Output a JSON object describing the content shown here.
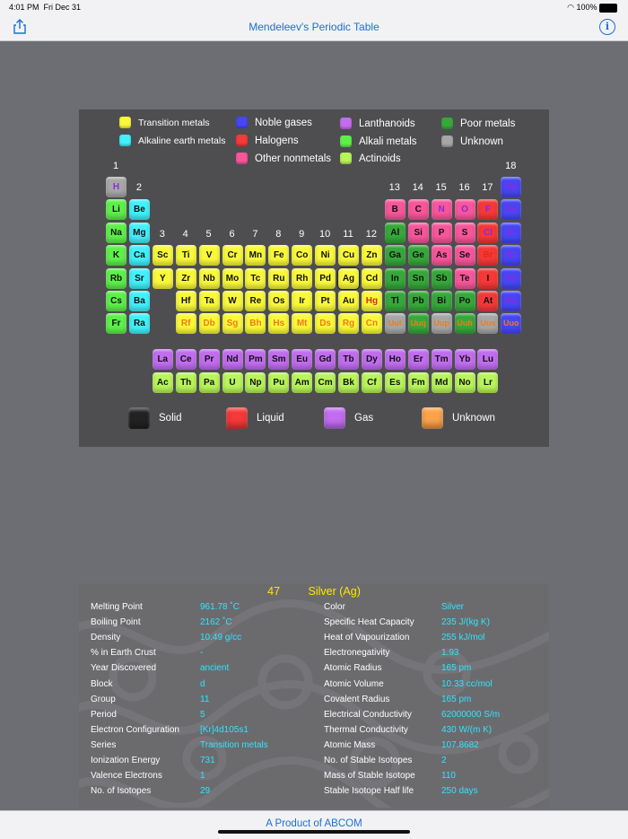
{
  "status": {
    "time": "4:01 PM",
    "date": "Fri Dec 31",
    "battery": "100%"
  },
  "nav": {
    "title": "Mendeleev's Periodic Table",
    "info": "i"
  },
  "colors": {
    "transition": "#f9f93a",
    "alkaline": "#41f1fb",
    "noble": "#4646f5",
    "halogen": "#f53838",
    "nonmetal": "#f7569a",
    "lanthanoid": "#c26df0",
    "alkali": "#5ef04a",
    "actinoid": "#b8f45a",
    "poor": "#36a83a",
    "unknown": "#a7a7a7",
    "accent": "#1a6fd6",
    "highlight": "#ffe700",
    "value": "#2ee6ff"
  },
  "legend": [
    {
      "label": "Transition metals",
      "color": "#f9f93a"
    },
    {
      "label": "Alkaline earth metals",
      "color": "#41f1fb"
    },
    {
      "label": "Noble gases",
      "color": "#4646f5"
    },
    {
      "label": "Halogens",
      "color": "#f53838"
    },
    {
      "label": "Other nonmetals",
      "color": "#f7569a"
    },
    {
      "label": "Lanthanoids",
      "color": "#c26df0"
    },
    {
      "label": "Alkali metals",
      "color": "#5ef04a"
    },
    {
      "label": "Actinoids",
      "color": "#b8f45a"
    },
    {
      "label": "Poor metals",
      "color": "#36a83a"
    },
    {
      "label": "Unknown",
      "color": "#a7a7a7"
    }
  ],
  "groups": [
    "1",
    "2",
    "3",
    "4",
    "5",
    "6",
    "7",
    "8",
    "9",
    "10",
    "11",
    "12",
    "13",
    "14",
    "15",
    "16",
    "17",
    "18"
  ],
  "elements": [
    {
      "symbol": "H",
      "group": 1,
      "period": 1,
      "series": "unknown",
      "state": "gas"
    },
    {
      "symbol": "He",
      "group": 18,
      "period": 1,
      "series": "noble",
      "state": "gas"
    },
    {
      "symbol": "Li",
      "group": 1,
      "period": 2,
      "series": "alkali",
      "state": "solid"
    },
    {
      "symbol": "Be",
      "group": 2,
      "period": 2,
      "series": "alkaline",
      "state": "solid"
    },
    {
      "symbol": "B",
      "group": 13,
      "period": 2,
      "series": "nonmetal",
      "state": "solid"
    },
    {
      "symbol": "C",
      "group": 14,
      "period": 2,
      "series": "nonmetal",
      "state": "solid"
    },
    {
      "symbol": "N",
      "group": 15,
      "period": 2,
      "series": "nonmetal",
      "state": "gas"
    },
    {
      "symbol": "O",
      "group": 16,
      "period": 2,
      "series": "nonmetal",
      "state": "gas"
    },
    {
      "symbol": "F",
      "group": 17,
      "period": 2,
      "series": "halogen",
      "state": "gas"
    },
    {
      "symbol": "Ne",
      "group": 18,
      "period": 2,
      "series": "noble",
      "state": "gas"
    },
    {
      "symbol": "Na",
      "group": 1,
      "period": 3,
      "series": "alkali",
      "state": "solid"
    },
    {
      "symbol": "Mg",
      "group": 2,
      "period": 3,
      "series": "alkaline",
      "state": "solid"
    },
    {
      "symbol": "Al",
      "group": 13,
      "period": 3,
      "series": "poor",
      "state": "solid"
    },
    {
      "symbol": "Si",
      "group": 14,
      "period": 3,
      "series": "nonmetal",
      "state": "solid"
    },
    {
      "symbol": "P",
      "group": 15,
      "period": 3,
      "series": "nonmetal",
      "state": "solid"
    },
    {
      "symbol": "S",
      "group": 16,
      "period": 3,
      "series": "nonmetal",
      "state": "solid"
    },
    {
      "symbol": "Cl",
      "group": 17,
      "period": 3,
      "series": "halogen",
      "state": "gas"
    },
    {
      "symbol": "Ar",
      "group": 18,
      "period": 3,
      "series": "noble",
      "state": "gas"
    },
    {
      "symbol": "K",
      "group": 1,
      "period": 4,
      "series": "alkali",
      "state": "solid"
    },
    {
      "symbol": "Ca",
      "group": 2,
      "period": 4,
      "series": "alkaline",
      "state": "solid"
    },
    {
      "symbol": "Sc",
      "group": 3,
      "period": 4,
      "series": "transition",
      "state": "solid"
    },
    {
      "symbol": "Ti",
      "group": 4,
      "period": 4,
      "series": "transition",
      "state": "solid"
    },
    {
      "symbol": "V",
      "group": 5,
      "period": 4,
      "series": "transition",
      "state": "solid"
    },
    {
      "symbol": "Cr",
      "group": 6,
      "period": 4,
      "series": "transition",
      "state": "solid"
    },
    {
      "symbol": "Mn",
      "group": 7,
      "period": 4,
      "series": "transition",
      "state": "solid"
    },
    {
      "symbol": "Fe",
      "group": 8,
      "period": 4,
      "series": "transition",
      "state": "solid"
    },
    {
      "symbol": "Co",
      "group": 9,
      "period": 4,
      "series": "transition",
      "state": "solid"
    },
    {
      "symbol": "Ni",
      "group": 10,
      "period": 4,
      "series": "transition",
      "state": "solid"
    },
    {
      "symbol": "Cu",
      "group": 11,
      "period": 4,
      "series": "transition",
      "state": "solid"
    },
    {
      "symbol": "Zn",
      "group": 12,
      "period": 4,
      "series": "transition",
      "state": "solid"
    },
    {
      "symbol": "Ga",
      "group": 13,
      "period": 4,
      "series": "poor",
      "state": "solid"
    },
    {
      "symbol": "Ge",
      "group": 14,
      "period": 4,
      "series": "poor",
      "state": "solid"
    },
    {
      "symbol": "As",
      "group": 15,
      "period": 4,
      "series": "nonmetal",
      "state": "solid"
    },
    {
      "symbol": "Se",
      "group": 16,
      "period": 4,
      "series": "nonmetal",
      "state": "solid"
    },
    {
      "symbol": "Br",
      "group": 17,
      "period": 4,
      "series": "halogen",
      "state": "liquid"
    },
    {
      "symbol": "Kr",
      "group": 18,
      "period": 4,
      "series": "noble",
      "state": "gas"
    },
    {
      "symbol": "Rb",
      "group": 1,
      "period": 5,
      "series": "alkali",
      "state": "solid"
    },
    {
      "symbol": "Sr",
      "group": 2,
      "period": 5,
      "series": "alkaline",
      "state": "solid"
    },
    {
      "symbol": "Y",
      "group": 3,
      "period": 5,
      "series": "transition",
      "state": "solid"
    },
    {
      "symbol": "Zr",
      "group": 4,
      "period": 5,
      "series": "transition",
      "state": "solid"
    },
    {
      "symbol": "Nb",
      "group": 5,
      "period": 5,
      "series": "transition",
      "state": "solid"
    },
    {
      "symbol": "Mo",
      "group": 6,
      "period": 5,
      "series": "transition",
      "state": "solid"
    },
    {
      "symbol": "Tc",
      "group": 7,
      "period": 5,
      "series": "transition",
      "state": "solid"
    },
    {
      "symbol": "Ru",
      "group": 8,
      "period": 5,
      "series": "transition",
      "state": "solid"
    },
    {
      "symbol": "Rh",
      "group": 9,
      "period": 5,
      "series": "transition",
      "state": "solid"
    },
    {
      "symbol": "Pd",
      "group": 10,
      "period": 5,
      "series": "transition",
      "state": "solid"
    },
    {
      "symbol": "Ag",
      "group": 11,
      "period": 5,
      "series": "transition",
      "state": "solid",
      "selected": true
    },
    {
      "symbol": "Cd",
      "group": 12,
      "period": 5,
      "series": "transition",
      "state": "solid"
    },
    {
      "symbol": "In",
      "group": 13,
      "period": 5,
      "series": "poor",
      "state": "solid"
    },
    {
      "symbol": "Sn",
      "group": 14,
      "period": 5,
      "series": "poor",
      "state": "solid"
    },
    {
      "symbol": "Sb",
      "group": 15,
      "period": 5,
      "series": "poor",
      "state": "solid"
    },
    {
      "symbol": "Te",
      "group": 16,
      "period": 5,
      "series": "nonmetal",
      "state": "solid"
    },
    {
      "symbol": "I",
      "group": 17,
      "period": 5,
      "series": "halogen",
      "state": "solid"
    },
    {
      "symbol": "Xe",
      "group": 18,
      "period": 5,
      "series": "noble",
      "state": "gas"
    },
    {
      "symbol": "Cs",
      "group": 1,
      "period": 6,
      "series": "alkali",
      "state": "solid"
    },
    {
      "symbol": "Ba",
      "group": 2,
      "period": 6,
      "series": "alkaline",
      "state": "solid"
    },
    {
      "symbol": "Hf",
      "group": 4,
      "period": 6,
      "series": "transition",
      "state": "solid"
    },
    {
      "symbol": "Ta",
      "group": 5,
      "period": 6,
      "series": "transition",
      "state": "solid"
    },
    {
      "symbol": "W",
      "group": 6,
      "period": 6,
      "series": "transition",
      "state": "solid"
    },
    {
      "symbol": "Re",
      "group": 7,
      "period": 6,
      "series": "transition",
      "state": "solid"
    },
    {
      "symbol": "Os",
      "group": 8,
      "period": 6,
      "series": "transition",
      "state": "solid"
    },
    {
      "symbol": "Ir",
      "group": 9,
      "period": 6,
      "series": "transition",
      "state": "solid"
    },
    {
      "symbol": "Pt",
      "group": 10,
      "period": 6,
      "series": "transition",
      "state": "solid"
    },
    {
      "symbol": "Au",
      "group": 11,
      "period": 6,
      "series": "transition",
      "state": "solid"
    },
    {
      "symbol": "Hg",
      "group": 12,
      "period": 6,
      "series": "transition",
      "state": "liquid"
    },
    {
      "symbol": "Tl",
      "group": 13,
      "period": 6,
      "series": "poor",
      "state": "solid"
    },
    {
      "symbol": "Pb",
      "group": 14,
      "period": 6,
      "series": "poor",
      "state": "solid"
    },
    {
      "symbol": "Bi",
      "group": 15,
      "period": 6,
      "series": "poor",
      "state": "solid"
    },
    {
      "symbol": "Po",
      "group": 16,
      "period": 6,
      "series": "poor",
      "state": "solid"
    },
    {
      "symbol": "At",
      "group": 17,
      "period": 6,
      "series": "halogen",
      "state": "solid"
    },
    {
      "symbol": "Rn",
      "group": 18,
      "period": 6,
      "series": "noble",
      "state": "gas"
    },
    {
      "symbol": "Fr",
      "group": 1,
      "period": 7,
      "series": "alkali",
      "state": "solid"
    },
    {
      "symbol": "Ra",
      "group": 2,
      "period": 7,
      "series": "alkaline",
      "state": "solid"
    },
    {
      "symbol": "Rf",
      "group": 4,
      "period": 7,
      "series": "transition",
      "state": "unknown"
    },
    {
      "symbol": "Db",
      "group": 5,
      "period": 7,
      "series": "transition",
      "state": "unknown"
    },
    {
      "symbol": "Sg",
      "group": 6,
      "period": 7,
      "series": "transition",
      "state": "unknown"
    },
    {
      "symbol": "Bh",
      "group": 7,
      "period": 7,
      "series": "transition",
      "state": "unknown"
    },
    {
      "symbol": "Hs",
      "group": 8,
      "period": 7,
      "series": "transition",
      "state": "unknown"
    },
    {
      "symbol": "Mt",
      "group": 9,
      "period": 7,
      "series": "transition",
      "state": "unknown"
    },
    {
      "symbol": "Ds",
      "group": 10,
      "period": 7,
      "series": "transition",
      "state": "unknown"
    },
    {
      "symbol": "Rg",
      "group": 11,
      "period": 7,
      "series": "transition",
      "state": "unknown"
    },
    {
      "symbol": "Cn",
      "group": 12,
      "period": 7,
      "series": "transition",
      "state": "unknown"
    },
    {
      "symbol": "Uut",
      "group": 13,
      "period": 7,
      "series": "unknown",
      "state": "unknown"
    },
    {
      "symbol": "Uuq",
      "group": 14,
      "period": 7,
      "series": "poor",
      "state": "unknown"
    },
    {
      "symbol": "Uup",
      "group": 15,
      "period": 7,
      "series": "unknown",
      "state": "unknown"
    },
    {
      "symbol": "Uuh",
      "group": 16,
      "period": 7,
      "series": "poor",
      "state": "unknown"
    },
    {
      "symbol": "Uus",
      "group": 17,
      "period": 7,
      "series": "unknown",
      "state": "unknown"
    },
    {
      "symbol": "Uuo",
      "group": 18,
      "period": 7,
      "series": "noble",
      "state": "unknown"
    },
    {
      "symbol": "La",
      "group": 3,
      "period": 8,
      "series": "lanthanoid",
      "state": "solid"
    },
    {
      "symbol": "Ce",
      "group": 4,
      "period": 8,
      "series": "lanthanoid",
      "state": "solid"
    },
    {
      "symbol": "Pr",
      "group": 5,
      "period": 8,
      "series": "lanthanoid",
      "state": "solid"
    },
    {
      "symbol": "Nd",
      "group": 6,
      "period": 8,
      "series": "lanthanoid",
      "state": "solid"
    },
    {
      "symbol": "Pm",
      "group": 7,
      "period": 8,
      "series": "lanthanoid",
      "state": "solid"
    },
    {
      "symbol": "Sm",
      "group": 8,
      "period": 8,
      "series": "lanthanoid",
      "state": "solid"
    },
    {
      "symbol": "Eu",
      "group": 9,
      "period": 8,
      "series": "lanthanoid",
      "state": "solid"
    },
    {
      "symbol": "Gd",
      "group": 10,
      "period": 8,
      "series": "lanthanoid",
      "state": "solid"
    },
    {
      "symbol": "Tb",
      "group": 11,
      "period": 8,
      "series": "lanthanoid",
      "state": "solid"
    },
    {
      "symbol": "Dy",
      "group": 12,
      "period": 8,
      "series": "lanthanoid",
      "state": "solid"
    },
    {
      "symbol": "Ho",
      "group": 13,
      "period": 8,
      "series": "lanthanoid",
      "state": "solid"
    },
    {
      "symbol": "Er",
      "group": 14,
      "period": 8,
      "series": "lanthanoid",
      "state": "solid"
    },
    {
      "symbol": "Tm",
      "group": 15,
      "period": 8,
      "series": "lanthanoid",
      "state": "solid"
    },
    {
      "symbol": "Yb",
      "group": 16,
      "period": 8,
      "series": "lanthanoid",
      "state": "solid"
    },
    {
      "symbol": "Lu",
      "group": 17,
      "period": 8,
      "series": "lanthanoid",
      "state": "solid"
    },
    {
      "symbol": "Ac",
      "group": 3,
      "period": 9,
      "series": "actinoid",
      "state": "solid"
    },
    {
      "symbol": "Th",
      "group": 4,
      "period": 9,
      "series": "actinoid",
      "state": "solid"
    },
    {
      "symbol": "Pa",
      "group": 5,
      "period": 9,
      "series": "actinoid",
      "state": "solid"
    },
    {
      "symbol": "U",
      "group": 6,
      "period": 9,
      "series": "actinoid",
      "state": "solid"
    },
    {
      "symbol": "Np",
      "group": 7,
      "period": 9,
      "series": "actinoid",
      "state": "solid"
    },
    {
      "symbol": "Pu",
      "group": 8,
      "period": 9,
      "series": "actinoid",
      "state": "solid"
    },
    {
      "symbol": "Am",
      "group": 9,
      "period": 9,
      "series": "actinoid",
      "state": "solid"
    },
    {
      "symbol": "Cm",
      "group": 10,
      "period": 9,
      "series": "actinoid",
      "state": "solid"
    },
    {
      "symbol": "Bk",
      "group": 11,
      "period": 9,
      "series": "actinoid",
      "state": "solid"
    },
    {
      "symbol": "Cf",
      "group": 12,
      "period": 9,
      "series": "actinoid",
      "state": "solid"
    },
    {
      "symbol": "Es",
      "group": 13,
      "period": 9,
      "series": "actinoid",
      "state": "solid"
    },
    {
      "symbol": "Fm",
      "group": 14,
      "period": 9,
      "series": "actinoid",
      "state": "solid"
    },
    {
      "symbol": "Md",
      "group": 15,
      "period": 9,
      "series": "actinoid",
      "state": "solid"
    },
    {
      "symbol": "No",
      "group": 16,
      "period": 9,
      "series": "actinoid",
      "state": "solid"
    },
    {
      "symbol": "Lr",
      "group": 17,
      "period": 9,
      "series": "actinoid",
      "state": "solid"
    }
  ],
  "state_text_colors": {
    "solid": "#111111",
    "liquid": "#e02a1a",
    "gas": "#8a2ad8",
    "unknown": "#ee7b18"
  },
  "state_legend": [
    {
      "label": "Solid",
      "color": "#222222"
    },
    {
      "label": "Liquid",
      "color": "#f53838"
    },
    {
      "label": "Gas",
      "color": "#c26df0"
    },
    {
      "label": "Unknown",
      "color": "#fba24a"
    }
  ],
  "details": {
    "number": "47",
    "name": "Silver (Ag)",
    "left": [
      {
        "label": "Melting Point",
        "value": "961.78 ˚C"
      },
      {
        "label": "Boiling Point",
        "value": "2162 ˚C"
      },
      {
        "label": "Density",
        "value": "10.49 g/cc"
      },
      {
        "label": "% in Earth Crust",
        "value": "-"
      },
      {
        "label": "Year Discovered",
        "value": "ancient"
      },
      {
        "label": "Block",
        "value": "d"
      },
      {
        "label": "Group",
        "value": "11"
      },
      {
        "label": "Period",
        "value": "5"
      },
      {
        "label": "Electron Configuration",
        "value": "[Kr]4d105s1"
      },
      {
        "label": "Series",
        "value": "Transition metals"
      },
      {
        "label": "Ionization Energy",
        "value": "731"
      },
      {
        "label": "Valence Electrons",
        "value": "1"
      },
      {
        "label": "No. of Isotopes",
        "value": "29"
      }
    ],
    "right": [
      {
        "label": "Color",
        "value": "Silver"
      },
      {
        "label": "Specific Heat Capacity",
        "value": "235 J/(kg K)"
      },
      {
        "label": "Heat of Vapourization",
        "value": "255 kJ/mol"
      },
      {
        "label": "Electronegativity",
        "value": "1.93"
      },
      {
        "label": "Atomic Radius",
        "value": "165 pm"
      },
      {
        "label": "Atomic Volume",
        "value": "10.33 cc/mol"
      },
      {
        "label": "Covalent Radius",
        "value": "165 pm"
      },
      {
        "label": "Electrical Conductivity",
        "value": "62000000 S/m"
      },
      {
        "label": "Thermal Conductivity",
        "value": "430 W/(m K)"
      },
      {
        "label": "Atomic Mass",
        "value": "107.8682"
      },
      {
        "label": "No. of Stable Isotopes",
        "value": "2"
      },
      {
        "label": "Mass of Stable Isotope",
        "value": "110"
      },
      {
        "label": "Stable Isotope Half life",
        "value": "250 days"
      }
    ]
  },
  "footer": {
    "text": "A Product of ABCOM"
  }
}
